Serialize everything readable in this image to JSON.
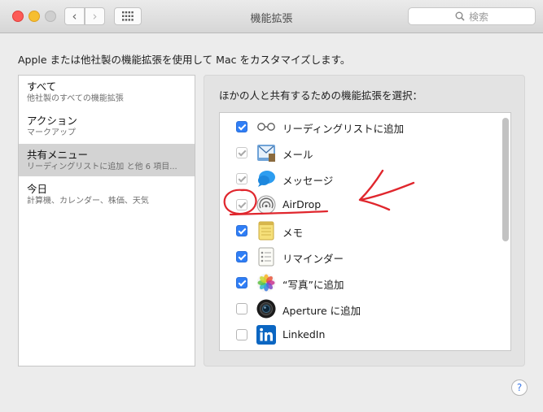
{
  "window": {
    "title": "機能拡張",
    "search_placeholder": "検索"
  },
  "description": "Apple または他社製の機能拡張を使用して Mac をカスタマイズします。",
  "categories": [
    {
      "title": "すべて",
      "subtitle": "他社製のすべての機能拡張",
      "selected": false
    },
    {
      "title": "アクション",
      "subtitle": "マークアップ",
      "selected": false
    },
    {
      "title": "共有メニュー",
      "subtitle": "リーディングリストに追加 と他 6 項目...",
      "selected": true
    },
    {
      "title": "今日",
      "subtitle": "計算機、カレンダー、株価、天気",
      "selected": false
    }
  ],
  "main": {
    "heading": "ほかの人と共有するための機能拡張を選択：",
    "items": [
      {
        "label": "リーディングリストに追加",
        "state": "checked",
        "icon": "reading-list-icon"
      },
      {
        "label": "メール",
        "state": "checked-disabled",
        "icon": "mail-icon"
      },
      {
        "label": "メッセージ",
        "state": "checked-disabled",
        "icon": "messages-icon"
      },
      {
        "label": "AirDrop",
        "state": "checked-disabled",
        "icon": "airdrop-icon"
      },
      {
        "label": "メモ",
        "state": "checked",
        "icon": "notes-icon"
      },
      {
        "label": "リマインダー",
        "state": "checked",
        "icon": "reminders-icon"
      },
      {
        "label": "“写真”に追加",
        "state": "checked",
        "icon": "photos-icon"
      },
      {
        "label": "Aperture に追加",
        "state": "unchecked",
        "icon": "aperture-icon"
      },
      {
        "label": "LinkedIn",
        "state": "unchecked",
        "icon": "linkedin-icon"
      }
    ]
  },
  "colors": {
    "accent": "#2f7ef6",
    "annotation": "#e0262d"
  }
}
